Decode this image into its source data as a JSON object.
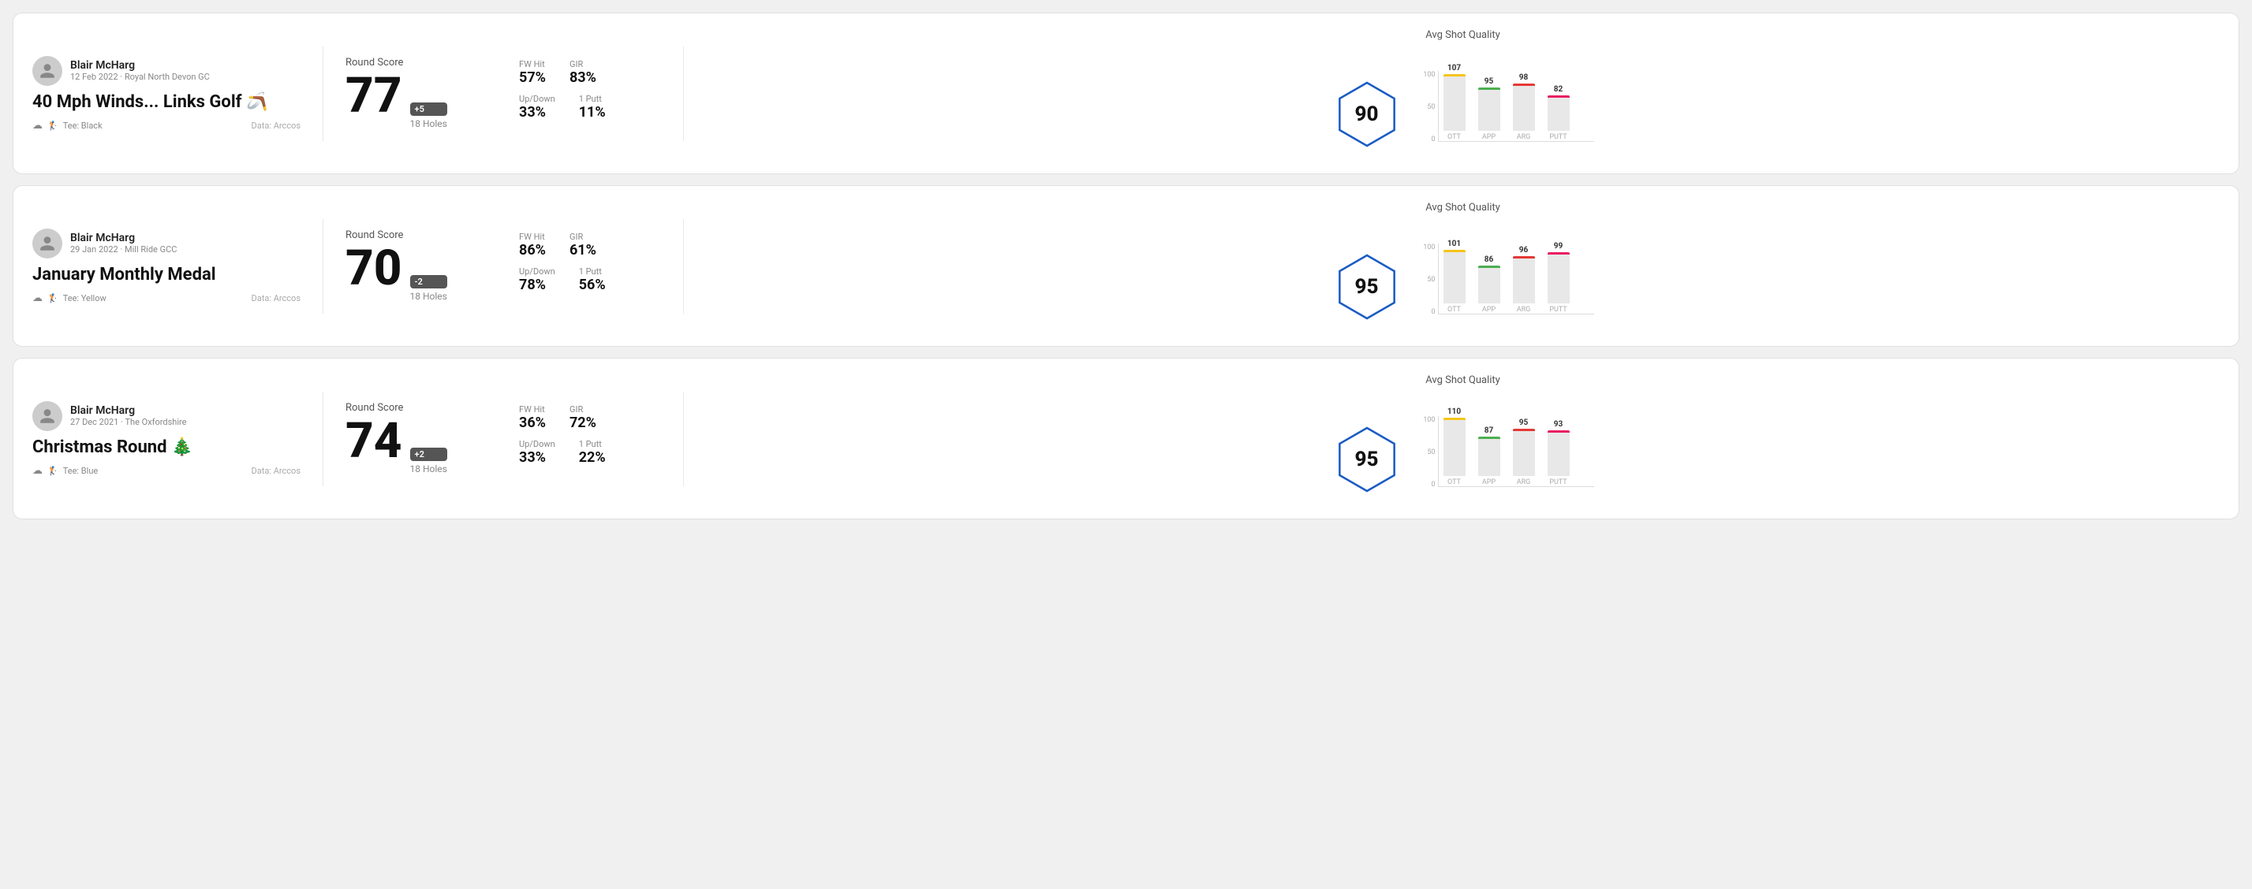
{
  "rounds": [
    {
      "id": "round-1",
      "user": {
        "name": "Blair McHarg",
        "date": "12 Feb 2022",
        "course": "Royal North Devon GC"
      },
      "title": "40 Mph Winds... Links Golf 🪃",
      "tee": "Black",
      "data_source": "Data: Arccos",
      "score": {
        "value": "77",
        "modifier": "+5",
        "holes": "18 Holes"
      },
      "stats": {
        "fw_hit_label": "FW Hit",
        "fw_hit_value": "57%",
        "gir_label": "GIR",
        "gir_value": "83%",
        "updown_label": "Up/Down",
        "updown_value": "33%",
        "oneputt_label": "1 Putt",
        "oneputt_value": "11%"
      },
      "quality": {
        "label": "Avg Shot Quality",
        "score": "90",
        "bars": [
          {
            "label": "OTT",
            "value": 107,
            "color": "#f5c518",
            "height": 72
          },
          {
            "label": "APP",
            "value": 95,
            "color": "#4caf50",
            "height": 55
          },
          {
            "label": "ARG",
            "value": 98,
            "color": "#e53935",
            "height": 60
          },
          {
            "label": "PUTT",
            "value": 82,
            "color": "#e91e63",
            "height": 45
          }
        ]
      }
    },
    {
      "id": "round-2",
      "user": {
        "name": "Blair McHarg",
        "date": "29 Jan 2022",
        "course": "Mill Ride GCC"
      },
      "title": "January Monthly Medal",
      "tee": "Yellow",
      "data_source": "Data: Arccos",
      "score": {
        "value": "70",
        "modifier": "-2",
        "holes": "18 Holes"
      },
      "stats": {
        "fw_hit_label": "FW Hit",
        "fw_hit_value": "86%",
        "gir_label": "GIR",
        "gir_value": "61%",
        "updown_label": "Up/Down",
        "updown_value": "78%",
        "oneputt_label": "1 Putt",
        "oneputt_value": "56%"
      },
      "quality": {
        "label": "Avg Shot Quality",
        "score": "95",
        "bars": [
          {
            "label": "OTT",
            "value": 101,
            "color": "#f5c518",
            "height": 68
          },
          {
            "label": "APP",
            "value": 86,
            "color": "#4caf50",
            "height": 48
          },
          {
            "label": "ARG",
            "value": 96,
            "color": "#e53935",
            "height": 60
          },
          {
            "label": "PUTT",
            "value": 99,
            "color": "#e91e63",
            "height": 65
          }
        ]
      }
    },
    {
      "id": "round-3",
      "user": {
        "name": "Blair McHarg",
        "date": "27 Dec 2021",
        "course": "The Oxfordshire"
      },
      "title": "Christmas Round 🎄",
      "tee": "Blue",
      "data_source": "Data: Arccos",
      "score": {
        "value": "74",
        "modifier": "+2",
        "holes": "18 Holes"
      },
      "stats": {
        "fw_hit_label": "FW Hit",
        "fw_hit_value": "36%",
        "gir_label": "GIR",
        "gir_value": "72%",
        "updown_label": "Up/Down",
        "updown_value": "33%",
        "oneputt_label": "1 Putt",
        "oneputt_value": "22%"
      },
      "quality": {
        "label": "Avg Shot Quality",
        "score": "95",
        "bars": [
          {
            "label": "OTT",
            "value": 110,
            "color": "#f5c518",
            "height": 74
          },
          {
            "label": "APP",
            "value": 87,
            "color": "#4caf50",
            "height": 50
          },
          {
            "label": "ARG",
            "value": 95,
            "color": "#e53935",
            "height": 60
          },
          {
            "label": "PUTT",
            "value": 93,
            "color": "#e91e63",
            "height": 58
          }
        ]
      }
    }
  ],
  "labels": {
    "round_score": "Round Score",
    "avg_shot_quality": "Avg Shot Quality",
    "data_arccos": "Data: Arccos"
  }
}
